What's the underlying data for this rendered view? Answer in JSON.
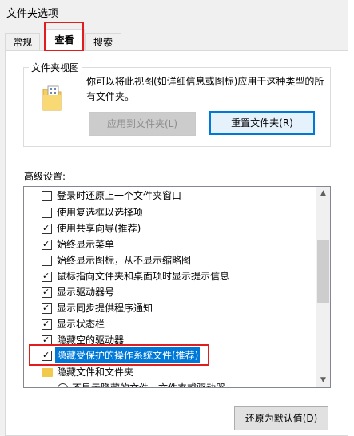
{
  "window": {
    "title": "文件夹选项"
  },
  "tabs": [
    {
      "label": "常规"
    },
    {
      "label": "查看"
    },
    {
      "label": "搜索"
    }
  ],
  "folder_view": {
    "group_label": "文件夹视图",
    "description": "你可以将此视图(如详细信息或图标)应用于这种类型的所有文件夹。",
    "apply_button": "应用到文件夹(L)",
    "reset_button": "重置文件夹(R)",
    "icon": "folder-icon"
  },
  "advanced": {
    "label": "高级设置:",
    "items": [
      {
        "type": "checkbox",
        "checked": false,
        "label": "登录时还原上一个文件夹窗口"
      },
      {
        "type": "checkbox",
        "checked": false,
        "label": "使用复选框以选择项"
      },
      {
        "type": "checkbox",
        "checked": true,
        "label": "使用共享向导(推荐)"
      },
      {
        "type": "checkbox",
        "checked": true,
        "label": "始终显示菜单"
      },
      {
        "type": "checkbox",
        "checked": false,
        "label": "始终显示图标，从不显示缩略图"
      },
      {
        "type": "checkbox",
        "checked": true,
        "label": "鼠标指向文件夹和桌面项时显示提示信息"
      },
      {
        "type": "checkbox",
        "checked": true,
        "label": "显示驱动器号"
      },
      {
        "type": "checkbox",
        "checked": true,
        "label": "显示同步提供程序通知"
      },
      {
        "type": "checkbox",
        "checked": true,
        "label": "显示状态栏"
      },
      {
        "type": "checkbox",
        "checked": true,
        "label": "隐藏空的驱动器"
      },
      {
        "type": "checkbox",
        "checked": true,
        "label": "隐藏受保护的操作系统文件(推荐)",
        "selected": true
      },
      {
        "type": "folder",
        "label": "隐藏文件和文件夹"
      },
      {
        "type": "radio",
        "label": "不显示隐藏的文件、文件夹或驱动器"
      }
    ]
  },
  "restore_button": "还原为默认值(D)",
  "colors": {
    "highlight_outline": "#e01e1e",
    "selection": "#0078d7",
    "accent": "#0078d7"
  }
}
